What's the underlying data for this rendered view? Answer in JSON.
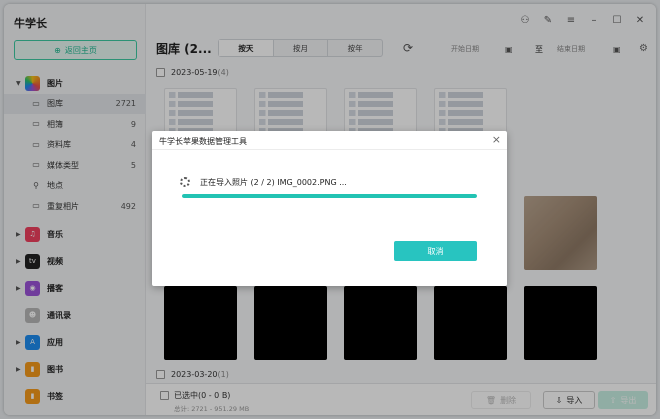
{
  "app": {
    "title": "牛学长"
  },
  "sidebar": {
    "home_label": "返回主页",
    "categories": [
      {
        "label": "图片",
        "expanded": true,
        "color": "#f08a24"
      },
      {
        "label": "音乐",
        "color": "#f0415f"
      },
      {
        "label": "视频",
        "color": "#222222"
      },
      {
        "label": "播客",
        "color": "#9b54d8"
      },
      {
        "label": "通讯录",
        "color": "#b8b8b8"
      },
      {
        "label": "应用",
        "color": "#1e8cf0"
      },
      {
        "label": "图书",
        "color": "#f59a1b"
      },
      {
        "label": "书签",
        "color": "#f59a1b"
      }
    ],
    "photo_items": [
      {
        "label": "图库",
        "count": "2721",
        "icon": "image-icon",
        "glyph": "▭",
        "active": true
      },
      {
        "label": "相簿",
        "count": "9",
        "icon": "album-icon",
        "glyph": "▭"
      },
      {
        "label": "资料库",
        "count": "4",
        "icon": "library-icon",
        "glyph": "▭"
      },
      {
        "label": "媒体类型",
        "count": "5",
        "icon": "media-type-icon",
        "glyph": "▭"
      },
      {
        "label": "地点",
        "count": "",
        "icon": "location-icon",
        "glyph": "⚲"
      },
      {
        "label": "重复相片",
        "count": "492",
        "icon": "duplicate-icon",
        "glyph": "▭"
      }
    ]
  },
  "toolbar": {
    "title": "图库 (2...",
    "tabs": [
      {
        "label": "按天",
        "active": true
      },
      {
        "label": "按月"
      },
      {
        "label": "按年"
      }
    ],
    "start_date_placeholder": "开始日期",
    "date_separator": "至",
    "end_date_placeholder": "结束日期"
  },
  "groups": [
    {
      "date": "2023-05-19",
      "count": "(4)"
    },
    {
      "date": "2023-03-20",
      "count": "(1)"
    }
  ],
  "footer": {
    "selected": "已选中(0 - 0 B)",
    "total": "总计: 2721 - 951.29 MB",
    "delete_label": "删除",
    "import_label": "导入",
    "export_label": "导出"
  },
  "dialog": {
    "title": "牛学长苹果数据管理工具",
    "progress_text": "正在导入照片 (2 / 2) IMG_0002.PNG ...",
    "progress": 1.0,
    "cancel_label": "取消"
  },
  "colors": {
    "accent": "#22c3b3",
    "home_green": "#1fb890"
  }
}
